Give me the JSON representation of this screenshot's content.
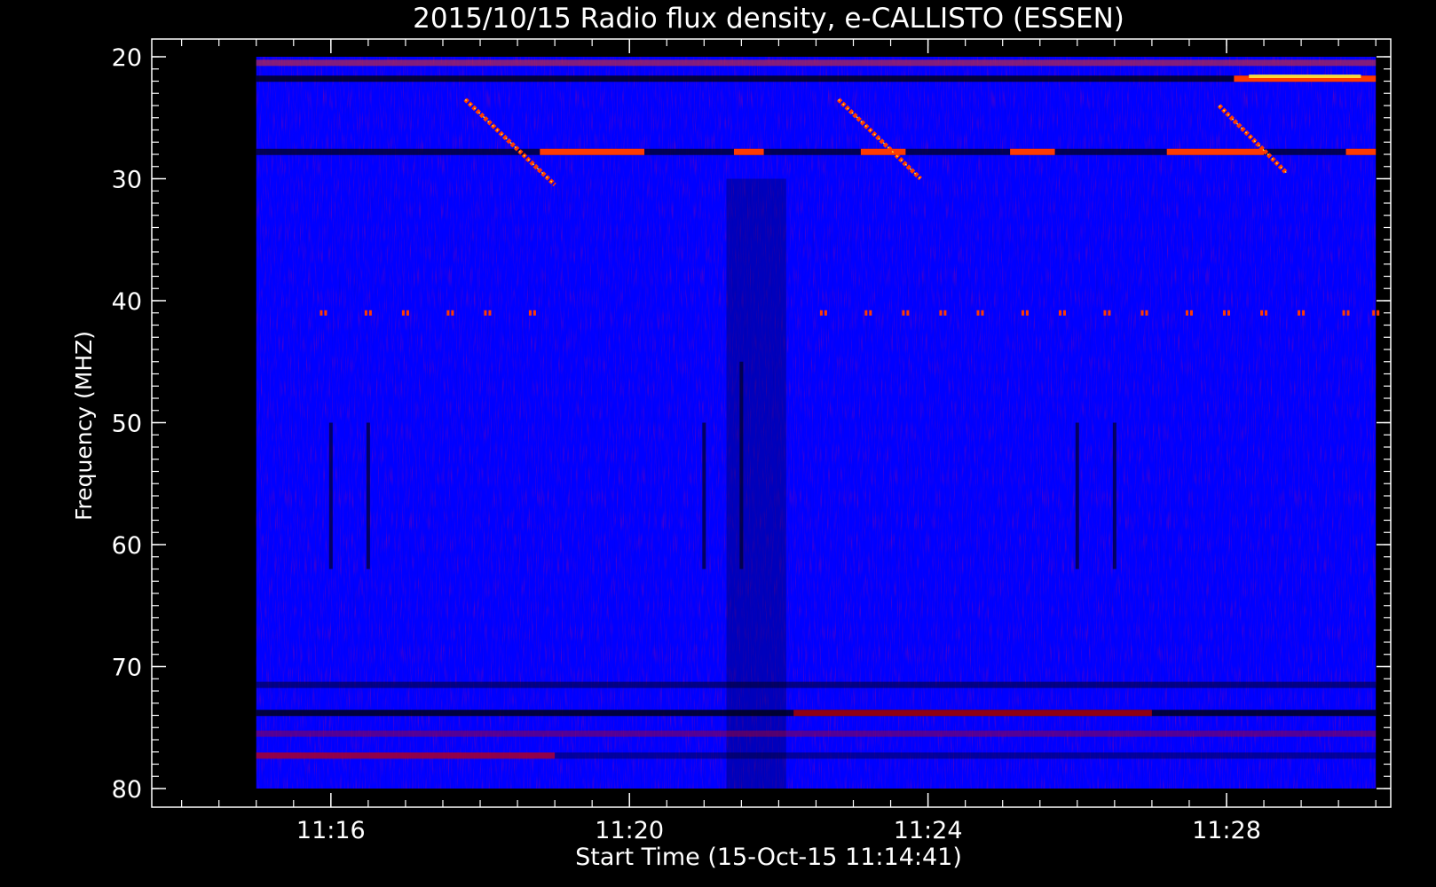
{
  "chart_data": {
    "type": "heatmap",
    "title": "2015/10/15  Radio flux density, e-CALLISTO (ESSEN)",
    "xlabel": "Start Time (15-Oct-15 11:14:41)",
    "ylabel": "Frequency (MHZ)",
    "x_unit": "minutes",
    "xlim": [
      13.6,
      30.2
    ],
    "ylim": [
      80,
      20
    ],
    "data_extent": {
      "time_start": 15.0,
      "time_end": 30.0,
      "freq_min": 20,
      "freq_max": 80
    },
    "x_ticks": [
      {
        "value": 16,
        "label": "11:16"
      },
      {
        "value": 20,
        "label": "11:20"
      },
      {
        "value": 24,
        "label": "11:24"
      },
      {
        "value": 28,
        "label": "11:28"
      }
    ],
    "x_minor_step": 0.5,
    "y_ticks": [
      {
        "value": 20,
        "label": "20"
      },
      {
        "value": 30,
        "label": "30"
      },
      {
        "value": 40,
        "label": "40"
      },
      {
        "value": 50,
        "label": "50"
      },
      {
        "value": 60,
        "label": "60"
      },
      {
        "value": 70,
        "label": "70"
      },
      {
        "value": 80,
        "label": "80"
      }
    ],
    "y_minor_step": 1,
    "colors": {
      "background": "#0000ff",
      "hot": "#ff3a00",
      "warm": "#cc0000",
      "dark": "#000010",
      "peak": "#ffff40"
    },
    "drift_bursts": [
      {
        "t_start": 17.8,
        "f_start": 23.5,
        "t_end": 19.0,
        "f_end": 30.5
      },
      {
        "t_start": 22.8,
        "f_start": 23.5,
        "t_end": 23.9,
        "f_end": 30.0
      },
      {
        "t_start": 27.9,
        "f_start": 24.0,
        "t_end": 28.8,
        "f_end": 29.5
      }
    ],
    "horizontal_bands": [
      {
        "freq": 20.5,
        "t_start": 15.0,
        "t_end": 30.0,
        "color": "hot",
        "intensity": 0.5
      },
      {
        "freq": 21.8,
        "t_start": 15.0,
        "t_end": 30.0,
        "color": "dark",
        "intensity": 0.8
      },
      {
        "freq": 21.8,
        "t_start": 28.1,
        "t_end": 30.0,
        "color": "hot",
        "intensity": 1.0
      },
      {
        "freq": 21.6,
        "t_start": 28.3,
        "t_end": 29.8,
        "color": "peak",
        "intensity": 0.8
      },
      {
        "freq": 27.8,
        "t_start": 15.0,
        "t_end": 30.0,
        "color": "dark",
        "intensity": 0.7
      },
      {
        "freq": 27.8,
        "t_start": 18.8,
        "t_end": 20.2,
        "color": "hot",
        "intensity": 1.0
      },
      {
        "freq": 27.8,
        "t_start": 21.4,
        "t_end": 21.8,
        "color": "hot",
        "intensity": 1.0
      },
      {
        "freq": 27.8,
        "t_start": 23.1,
        "t_end": 23.7,
        "color": "hot",
        "intensity": 1.0
      },
      {
        "freq": 27.8,
        "t_start": 25.1,
        "t_end": 25.7,
        "color": "hot",
        "intensity": 1.0
      },
      {
        "freq": 27.8,
        "t_start": 27.2,
        "t_end": 28.5,
        "color": "hot",
        "intensity": 1.0
      },
      {
        "freq": 27.8,
        "t_start": 29.6,
        "t_end": 30.0,
        "color": "hot",
        "intensity": 1.0
      },
      {
        "freq": 71.5,
        "t_start": 15.0,
        "t_end": 30.0,
        "color": "dark",
        "intensity": 0.5
      },
      {
        "freq": 73.8,
        "t_start": 15.0,
        "t_end": 30.0,
        "color": "dark",
        "intensity": 0.8
      },
      {
        "freq": 73.8,
        "t_start": 22.2,
        "t_end": 27.0,
        "color": "warm",
        "intensity": 0.7
      },
      {
        "freq": 75.5,
        "t_start": 15.0,
        "t_end": 30.0,
        "color": "warm",
        "intensity": 0.4
      },
      {
        "freq": 77.3,
        "t_start": 15.0,
        "t_end": 19.0,
        "color": "warm",
        "intensity": 0.7
      },
      {
        "freq": 77.3,
        "t_start": 19.0,
        "t_end": 30.0,
        "color": "dark",
        "intensity": 0.4
      }
    ],
    "periodic_dots": {
      "freq": 41.0,
      "times": [
        15.9,
        16.5,
        17.0,
        17.6,
        18.1,
        18.7,
        22.6,
        23.2,
        23.7,
        24.2,
        24.7,
        25.3,
        25.8,
        26.4,
        26.9,
        27.5,
        28.0,
        28.5,
        29.0,
        29.6,
        30.0
      ]
    },
    "dark_vertical_stripes": [
      {
        "t": 16.0,
        "f_start": 50,
        "f_end": 62
      },
      {
        "t": 16.5,
        "f_start": 50,
        "f_end": 62
      },
      {
        "t": 21.0,
        "f_start": 50,
        "f_end": 62
      },
      {
        "t": 21.5,
        "f_start": 45,
        "f_end": 62
      },
      {
        "t": 26.0,
        "f_start": 50,
        "f_end": 62
      },
      {
        "t": 26.5,
        "f_start": 50,
        "f_end": 62
      }
    ],
    "dim_region": {
      "t_start": 21.3,
      "t_end": 22.1,
      "f_start": 30,
      "f_end": 80
    },
    "grid": false,
    "legend": "none"
  }
}
